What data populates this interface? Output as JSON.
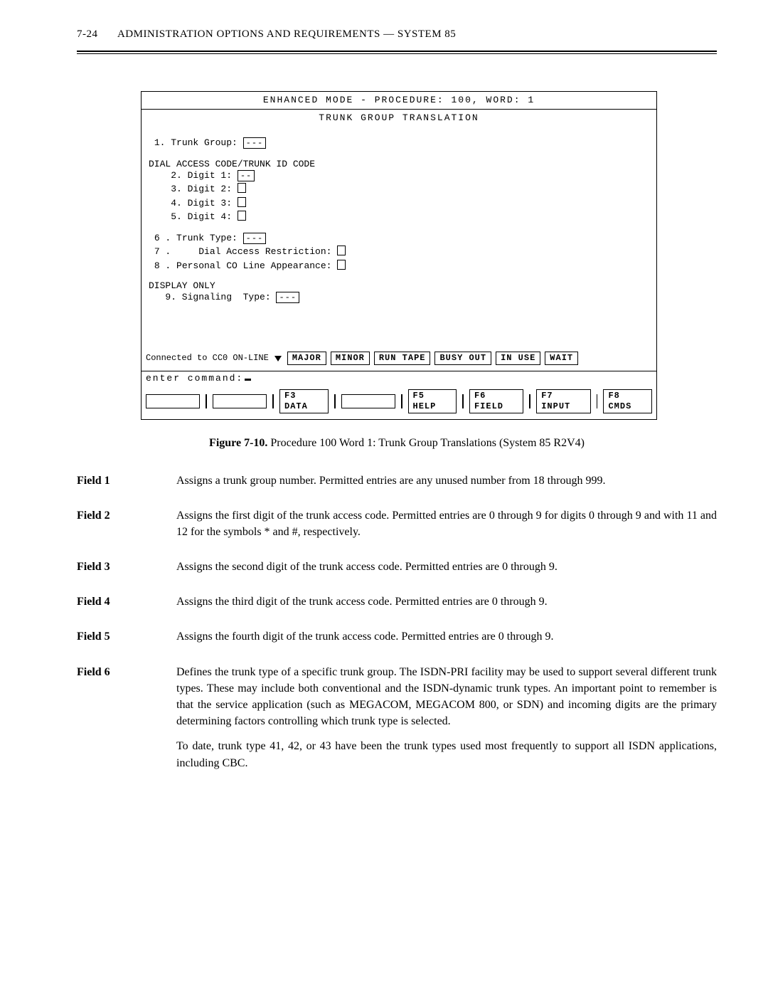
{
  "header": {
    "page_number": "7-24",
    "title": "ADMINISTRATION  OPTIONS  AND  REQUIREMENTS  —  SYSTEM  85"
  },
  "terminal": {
    "title": "ENHANCED  MODE  -  PROCEDURE:   100,  WORD:    1",
    "subtitle": "TRUNK   GROUP   TRANSLATION",
    "lines": {
      "l1": "1. Trunk Group:",
      "section_dial": "DIAL ACCESS CODE/TRUNK ID CODE",
      "l2": "2. Digit 1:",
      "l3": "3. Digit 2:",
      "l4": "4. Digit 3:",
      "l5": "5. Digit 4:",
      "l6": "6 . Trunk Type:",
      "l7": "7 .     Dial Access Restriction:",
      "l8": "8 . Personal CO Line Appearance:",
      "section_display": "DISPLAY ONLY",
      "l9": "9. Signaling  Type:"
    },
    "box_dashes": "---",
    "box_short_dashes": "--",
    "status": {
      "prefix": "Connected to CC0 ON-LINE",
      "pills": [
        "MAJOR",
        "MINOR",
        "RUN TAPE",
        "BUSY OUT",
        "IN USE",
        "WAIT"
      ]
    },
    "command_label": "enter  command:",
    "fkeys": [
      "F3 DATA",
      "F5 HELP",
      "F6 FIELD",
      "F7 INPUT",
      "F8 CMDS"
    ]
  },
  "caption": {
    "strong": "Figure 7-10.",
    "rest": " Procedure  100  Word  1:  Trunk  Group  Translations  (System  85  R2V4)"
  },
  "fields": [
    {
      "label": "Field 1",
      "paras": [
        "Assigns  a  trunk  group  number.  Permitted  entries  are  any  unused  number  from  18 through  999."
      ]
    },
    {
      "label": "Field 2",
      "paras": [
        "Assigns  the  first  digit  of  the  trunk  access  code.  Permitted  entries  are  0  through  9  for digits 0 through 9 and with 11 and 12 for the symbols * and #, respectively."
      ]
    },
    {
      "label": "Field 3",
      "paras": [
        "Assigns  the  second  digit  of  the  trunk  access  code.  Permitted  entries  are  0  through  9."
      ]
    },
    {
      "label": "Field 4",
      "paras": [
        "Assigns  the  third  digit  of  the  trunk  access  code.  Permitted  entries  are  0  through  9."
      ]
    },
    {
      "label": "Field 5",
      "paras": [
        "Assigns  the  fourth  digit  of  the  trunk  access  code.  Permitted  entries  are  0  through  9."
      ]
    },
    {
      "label": "Field 6",
      "paras": [
        "Defines  the  trunk  type  of  a  specific  trunk  group.  The  ISDN-PRI  facility  may  be used  to  support  several  different  trunk  types.  These  may  include  both  conventional and  the  ISDN-dynamic  trunk  types.  An  important  point  to  remember  is  that  the service  application  (such  as  MEGACOM,  MEGACOM  800,  or  SDN)  and  incoming digits are the primary determining factors controlling which trunk type is selected.",
        "To  date,  trunk  type  41,  42,  or  43  have  been  the  trunk  types  used  most  frequently  to support  all  ISDN  applications,  including  CBC."
      ]
    }
  ]
}
